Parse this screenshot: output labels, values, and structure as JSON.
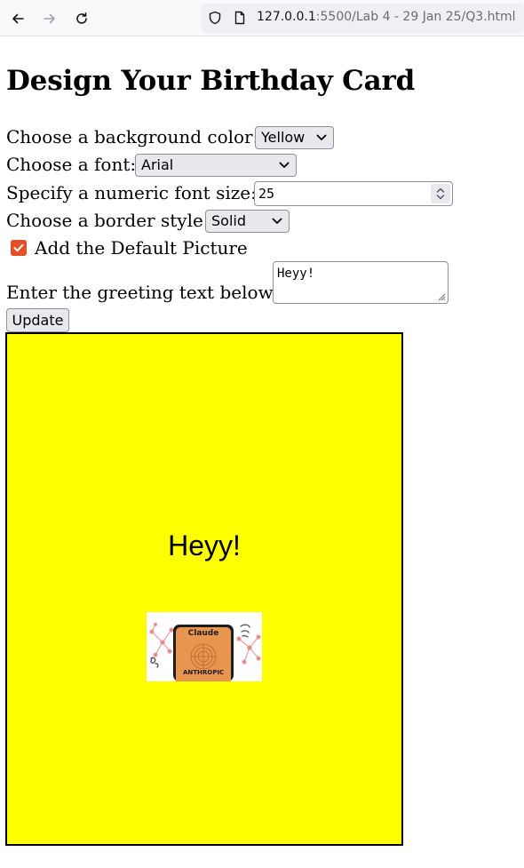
{
  "browser": {
    "url_host": "127.0.0.1",
    "url_rest": ":5500/Lab 4 - 29 Jan 25/Q3.html"
  },
  "page": {
    "heading": "Design Your Birthday Card",
    "bg_label": "Choose a background color:",
    "bg_value": "Yellow",
    "font_label": "Choose a font:",
    "font_value": "Arial",
    "size_label": "Specify a numeric font size:",
    "size_value": "25",
    "border_label": "Choose a border style:",
    "border_value": "Solid",
    "picture_label": "Add the Default Picture",
    "picture_checked": true,
    "greeting_label": "Enter the greeting text below:",
    "greeting_value": "Heyy!",
    "update_label": "Update"
  },
  "card": {
    "background": "#ffff00",
    "border": "#000000",
    "greeting": "Heyy!",
    "picture": {
      "top_text": "Claude",
      "bottom_text": "ANTHROPIC"
    }
  },
  "colors": {
    "checkbox": "#e34f26",
    "tile": "#e8954f"
  }
}
